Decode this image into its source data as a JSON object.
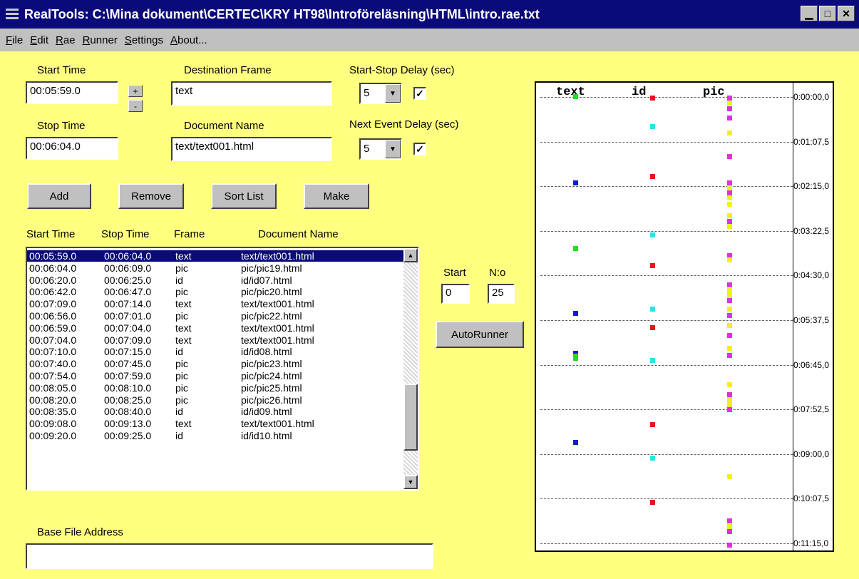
{
  "window": {
    "title": "RealTools: C:\\Mina dokument\\CERTEC\\KRY HT98\\Introföreläsning\\HTML\\intro.rae.txt",
    "min_glyph": "▁",
    "max_glyph": "□",
    "close_glyph": "✕"
  },
  "menu": [
    "File",
    "Edit",
    "Rae",
    "Runner",
    "Settings",
    "About..."
  ],
  "form": {
    "start_time_label": "Start Time",
    "start_time_value": "00:05:59.0",
    "stop_time_label": "Stop Time",
    "stop_time_value": "00:06:04.0",
    "plus_label": "+",
    "minus_label": "-",
    "destination_frame_label": "Destination Frame",
    "destination_frame_value": "text",
    "document_name_label": "Document Name",
    "document_name_value": "text/text001.html",
    "start_stop_delay_label": "Start-Stop Delay (sec)",
    "start_stop_delay_value": "5",
    "start_stop_delay_checked": "✓",
    "next_event_delay_label": "Next Event Delay (sec)",
    "next_event_delay_value": "5",
    "next_event_delay_checked": "✓"
  },
  "buttons": {
    "add": "Add",
    "remove": "Remove",
    "sort_list": "Sort List",
    "make": "Make",
    "autorunner": "AutoRunner"
  },
  "list": {
    "headers": [
      "Start Time",
      "Stop Time",
      "Frame",
      "Document Name"
    ],
    "rows": [
      [
        "00:05:59.0",
        "00:06:04.0",
        "text",
        "text/text001.html"
      ],
      [
        "00:06:04.0",
        "00:06:09.0",
        "pic",
        "pic/pic19.html"
      ],
      [
        "00:06:20.0",
        "00:06:25.0",
        "id",
        "id/id07.html"
      ],
      [
        "00:06:42.0",
        "00:06:47.0",
        "pic",
        "pic/pic20.html"
      ],
      [
        "00:07:09.0",
        "00:07:14.0",
        "text",
        "text/text001.html"
      ],
      [
        "00:06:56.0",
        "00:07:01.0",
        "pic",
        "pic/pic22.html"
      ],
      [
        "00:06:59.0",
        "00:07:04.0",
        "text",
        "text/text001.html"
      ],
      [
        "00:07:04.0",
        "00:07:09.0",
        "text",
        "text/text001.html"
      ],
      [
        "00:07:10.0",
        "00:07:15.0",
        "id",
        "id/id08.html"
      ],
      [
        "00:07:40.0",
        "00:07:45.0",
        "pic",
        "pic/pic23.html"
      ],
      [
        "00:07:54.0",
        "00:07:59.0",
        "pic",
        "pic/pic24.html"
      ],
      [
        "00:08:05.0",
        "00:08:10.0",
        "pic",
        "pic/pic25.html"
      ],
      [
        "00:08:20.0",
        "00:08:25.0",
        "pic",
        "pic/pic26.html"
      ],
      [
        "00:08:35.0",
        "00:08:40.0",
        "id",
        "id/id09.html"
      ],
      [
        "00:09:08.0",
        "00:09:13.0",
        "text",
        "text/text001.html"
      ],
      [
        "00:09:20.0",
        "00:09:25.0",
        "id",
        "id/id10.html"
      ]
    ],
    "selected_index": 0,
    "scroll_up_glyph": "▲",
    "scroll_down_glyph": "▼"
  },
  "runner": {
    "start_label": "Start",
    "start_value": "0",
    "count_label": "N:o",
    "count_value": "25"
  },
  "base_file": {
    "label": "Base File Address",
    "value": ""
  },
  "timeline": {
    "columns": [
      "text",
      "id",
      "pic"
    ],
    "ticks": [
      "0:00:00,0",
      "0:01:07,5",
      "0:02:15,0",
      "0:03:22,5",
      "0:04:30,0",
      "0:05:37,5",
      "0:06:45,0",
      "0:07:52,5",
      "0:09:00,0",
      "0:10:07,5",
      "0:11:15,0"
    ],
    "colors": {
      "green": "#22dd22",
      "blue": "#1020d0",
      "red": "#e01818",
      "cyan": "#30e0e8",
      "magenta": "#e030e0",
      "yellow": "#f0f020"
    },
    "marks": {
      "text": [
        {
          "t": 0.3,
          "c": "green"
        },
        {
          "t": 130,
          "c": "blue"
        },
        {
          "t": 229,
          "c": "green"
        },
        {
          "t": 327,
          "c": "blue"
        },
        {
          "t": 387,
          "c": "blue"
        },
        {
          "t": 391,
          "c": "green"
        },
        {
          "t": 395,
          "c": "green"
        },
        {
          "t": 521,
          "c": "blue"
        }
      ],
      "id": [
        {
          "t": 2,
          "c": "red"
        },
        {
          "t": 45,
          "c": "cyan"
        },
        {
          "t": 120,
          "c": "red"
        },
        {
          "t": 209,
          "c": "cyan"
        },
        {
          "t": 255,
          "c": "red"
        },
        {
          "t": 320,
          "c": "cyan"
        },
        {
          "t": 348,
          "c": "red"
        },
        {
          "t": 398,
          "c": "cyan"
        },
        {
          "t": 495,
          "c": "red"
        },
        {
          "t": 545,
          "c": "cyan"
        },
        {
          "t": 612,
          "c": "red"
        }
      ],
      "pic": [
        {
          "t": 2,
          "c": "magenta"
        },
        {
          "t": 10,
          "c": "yellow"
        },
        {
          "t": 18,
          "c": "magenta"
        },
        {
          "t": 32,
          "c": "magenta"
        },
        {
          "t": 55,
          "c": "yellow"
        },
        {
          "t": 90,
          "c": "magenta"
        },
        {
          "t": 130,
          "c": "magenta"
        },
        {
          "t": 138,
          "c": "yellow"
        },
        {
          "t": 145,
          "c": "magenta"
        },
        {
          "t": 153,
          "c": "yellow"
        },
        {
          "t": 162,
          "c": "yellow"
        },
        {
          "t": 180,
          "c": "yellow"
        },
        {
          "t": 188,
          "c": "magenta"
        },
        {
          "t": 196,
          "c": "yellow"
        },
        {
          "t": 240,
          "c": "magenta"
        },
        {
          "t": 246,
          "c": "yellow"
        },
        {
          "t": 284,
          "c": "magenta"
        },
        {
          "t": 292,
          "c": "yellow"
        },
        {
          "t": 300,
          "c": "yellow"
        },
        {
          "t": 307,
          "c": "magenta"
        },
        {
          "t": 320,
          "c": "yellow"
        },
        {
          "t": 330,
          "c": "magenta"
        },
        {
          "t": 345,
          "c": "yellow"
        },
        {
          "t": 360,
          "c": "magenta"
        },
        {
          "t": 380,
          "c": "yellow"
        },
        {
          "t": 390,
          "c": "magenta"
        },
        {
          "t": 434,
          "c": "yellow"
        },
        {
          "t": 449,
          "c": "magenta"
        },
        {
          "t": 457,
          "c": "yellow"
        },
        {
          "t": 464,
          "c": "yellow"
        },
        {
          "t": 472,
          "c": "magenta"
        },
        {
          "t": 573,
          "c": "yellow"
        },
        {
          "t": 640,
          "c": "magenta"
        },
        {
          "t": 648,
          "c": "yellow"
        },
        {
          "t": 656,
          "c": "magenta"
        },
        {
          "t": 676,
          "c": "magenta"
        }
      ]
    }
  }
}
